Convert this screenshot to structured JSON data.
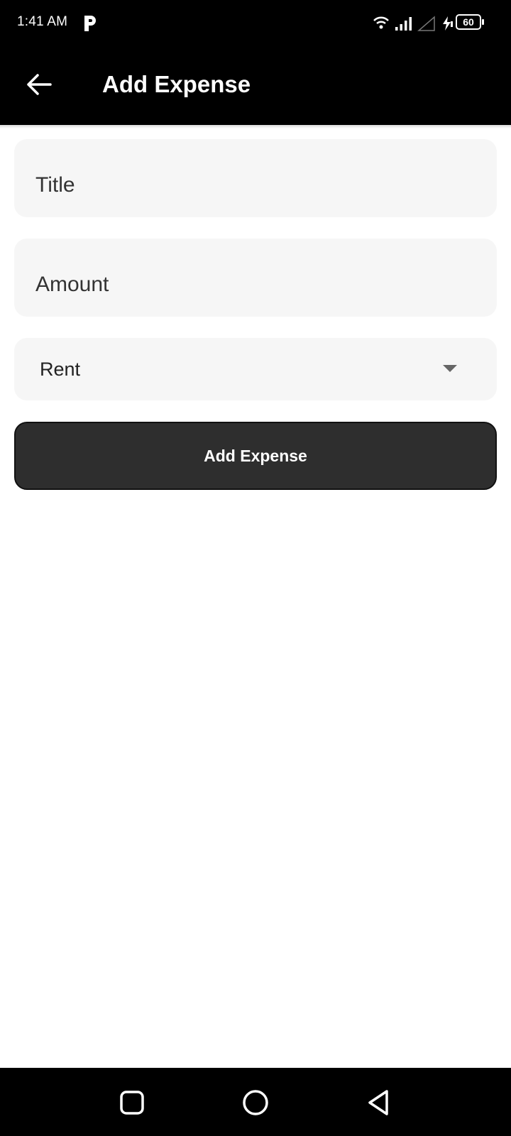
{
  "status_bar": {
    "time": "1:41 AM",
    "battery": "60",
    "icons": [
      "parking-app-icon",
      "wifi-icon",
      "signal-icon",
      "signal-empty-icon",
      "charging-icon",
      "battery-icon"
    ]
  },
  "app_bar": {
    "title": "Add Expense",
    "back_icon": "arrow-left-icon"
  },
  "form": {
    "title_placeholder": "Title",
    "amount_placeholder": "Amount",
    "category_selected": "Rent",
    "submit_label": "Add Expense"
  },
  "nav_bar": {
    "icons": [
      "recents-icon",
      "home-icon",
      "back-icon"
    ]
  },
  "colors": {
    "bar_background": "#000000",
    "field_background": "#f6f6f6",
    "button_background": "#2e2e2e",
    "text_on_dark": "#ffffff"
  }
}
